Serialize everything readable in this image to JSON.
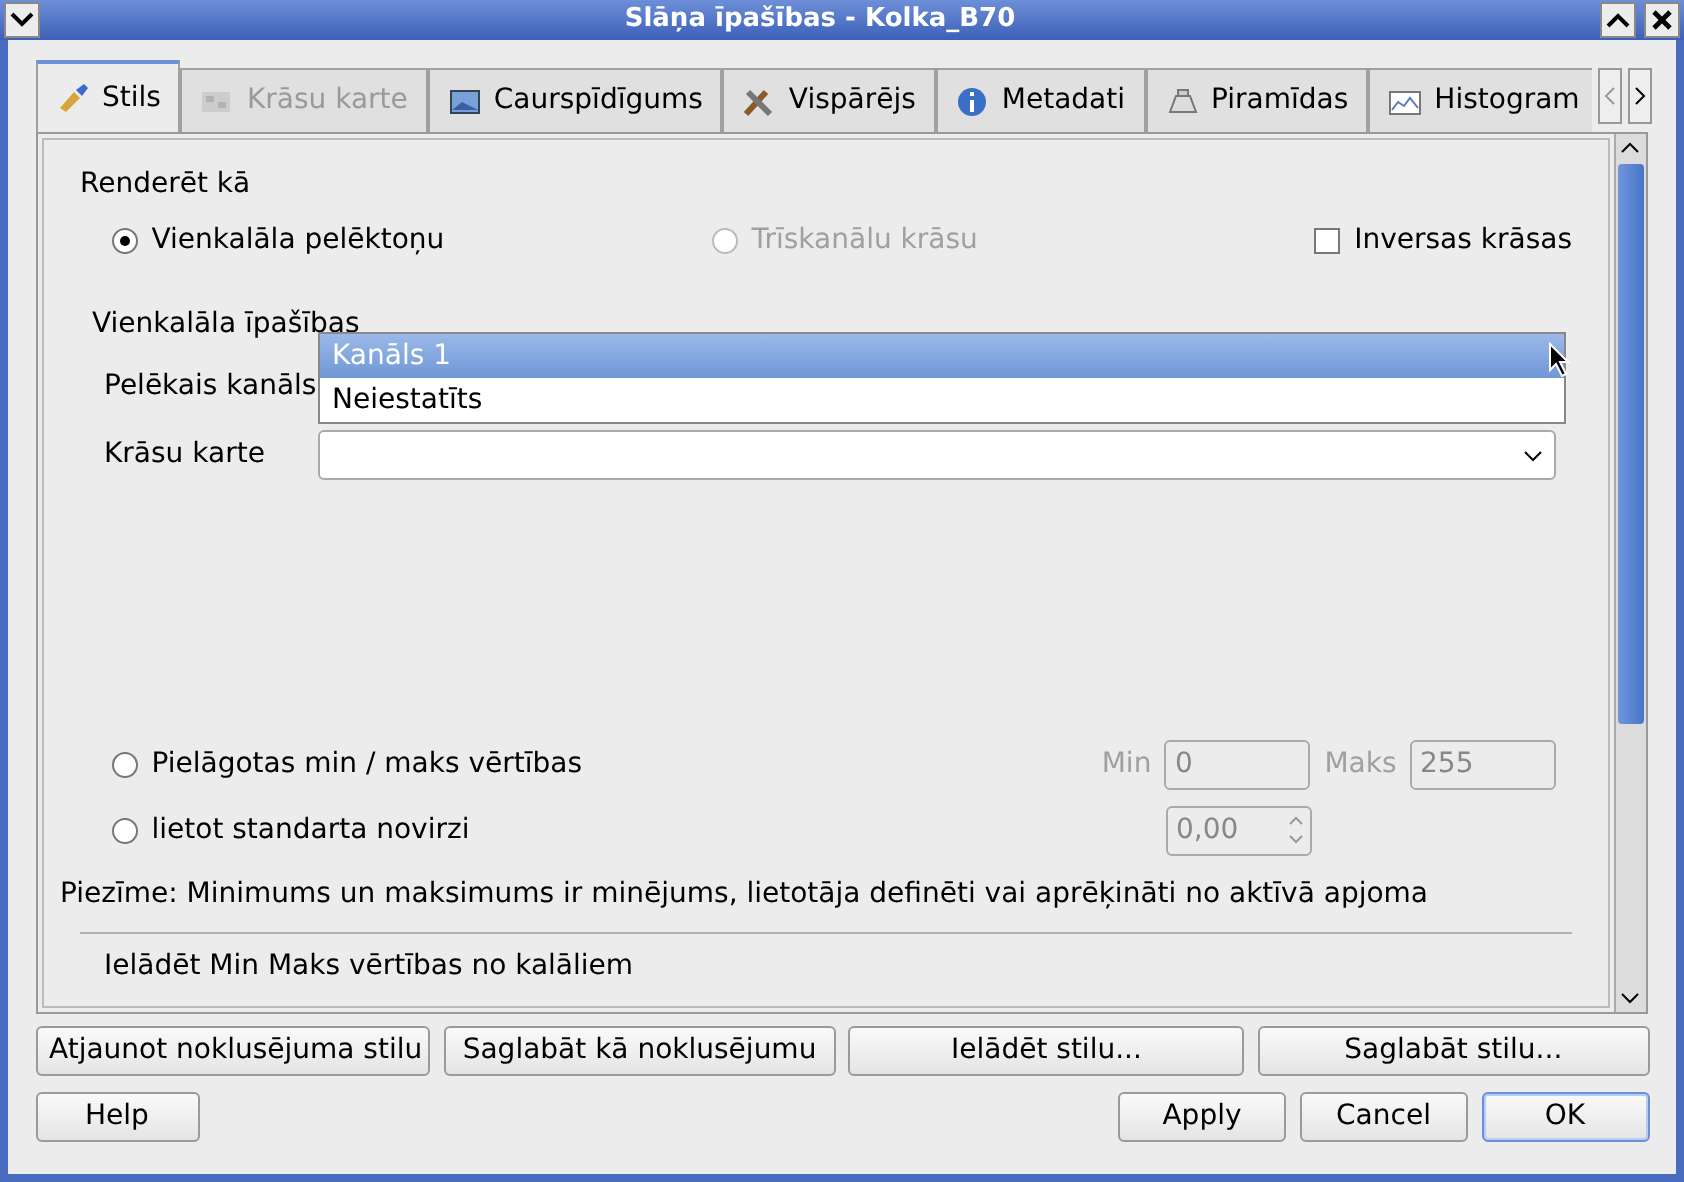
{
  "window": {
    "title": "Slāņa īpašības - Kolka_B70"
  },
  "tabs": [
    {
      "label": "Stils",
      "selected": true,
      "disabled": false
    },
    {
      "label": "Krāsu karte",
      "selected": false,
      "disabled": true
    },
    {
      "label": "Caurspīdīgums",
      "selected": false,
      "disabled": false
    },
    {
      "label": "Vispārējs",
      "selected": false,
      "disabled": false
    },
    {
      "label": "Metadati",
      "selected": false,
      "disabled": false
    },
    {
      "label": "Piramīdas",
      "selected": false,
      "disabled": false
    },
    {
      "label": "Histogram",
      "selected": false,
      "disabled": false
    }
  ],
  "render_as": {
    "label": "Renderēt kā",
    "options": [
      {
        "kind": "radio",
        "label": "Vienkalāla pelēktoņu",
        "selected": true,
        "disabled": false
      },
      {
        "kind": "radio",
        "label": "Trīskanālu krāsu",
        "selected": false,
        "disabled": true
      },
      {
        "kind": "checkbox",
        "label": "Inversas krāsas",
        "checked": false
      }
    ]
  },
  "single_band": {
    "label": "Vienkalāla īpašības",
    "gray_band": {
      "label": "Pelēkais kanāls",
      "expanded": true,
      "options": [
        {
          "label": "Kanāls 1",
          "selected": true
        },
        {
          "label": "Neiestatīts",
          "selected": false
        }
      ]
    },
    "color_map": {
      "label": "Krāsu karte"
    }
  },
  "minmax": [
    {
      "label": "Pielāgotas min / maks vērtības",
      "selected": false,
      "fields": [
        {
          "label": "Min",
          "value": "0"
        },
        {
          "label": "Maks",
          "value": "255"
        }
      ]
    },
    {
      "label": "lietot standarta novirzi",
      "selected": false,
      "spin": "0,00"
    }
  ],
  "note": "Piezīme: Minimums un maksimums ir minējums, lietotāja definēti vai aprēķināti no aktīvā apjoma",
  "cut_section": "Ielādēt Min Maks vērtības no kalāliem",
  "style_buttons": [
    "Atjaunot noklusējuma stilu",
    "Saglabāt kā noklusējumu",
    "Ielādēt stilu...",
    "Saglabāt stilu..."
  ],
  "help_button": "Help",
  "dialog_buttons": [
    {
      "label": "Apply",
      "default": false
    },
    {
      "label": "Cancel",
      "default": false
    },
    {
      "label": "OK",
      "default": true
    }
  ]
}
